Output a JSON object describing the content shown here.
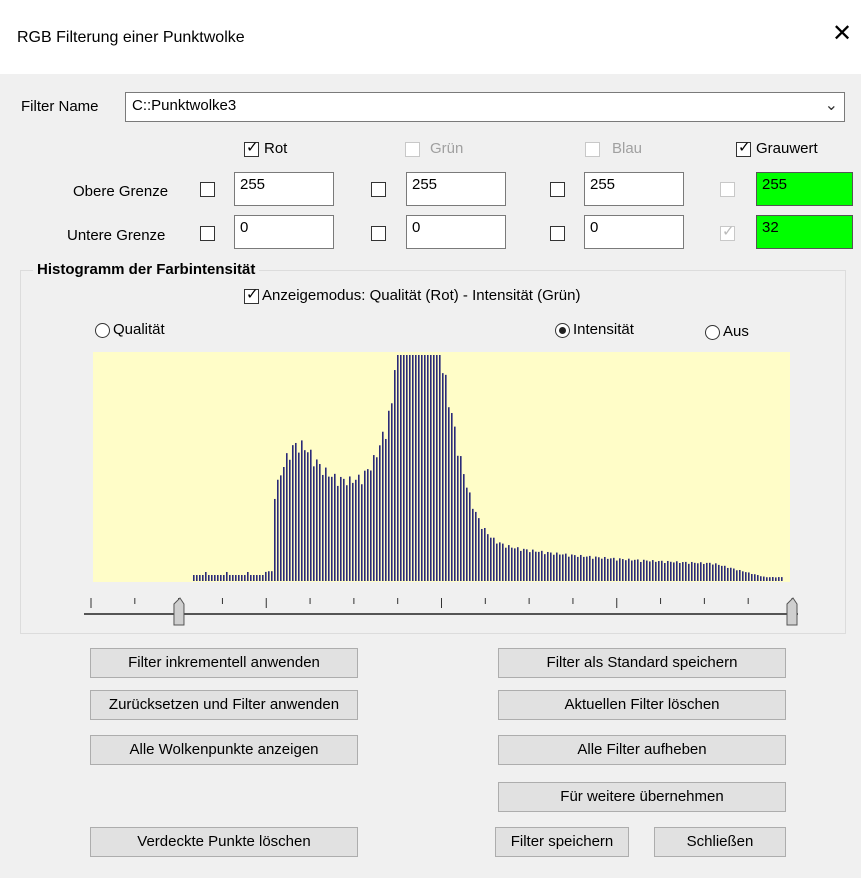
{
  "window": {
    "title": "RGB Filterung einer Punktwolke",
    "close_glyph": "✕"
  },
  "filter_name": {
    "label": "Filter Name",
    "value": "C::Punktwolke3"
  },
  "channels": [
    {
      "label": "Rot",
      "checked": true,
      "enabled": true
    },
    {
      "label": "Grün",
      "checked": false,
      "enabled": false
    },
    {
      "label": "Blau",
      "checked": false,
      "enabled": false
    },
    {
      "label": "Grauwert",
      "checked": true,
      "enabled": true
    }
  ],
  "upper": {
    "label": "Obere Grenze",
    "values": [
      "255",
      "255",
      "255",
      "255"
    ]
  },
  "lower": {
    "label": "Untere Grenze",
    "values": [
      "0",
      "0",
      "0",
      "32"
    ]
  },
  "histogram": {
    "title": "Histogramm der Farbintensität",
    "mode_label": "Anzeigemodus: Qualität (Rot) - Intensität (Grün)",
    "mode_checked": true,
    "radios": [
      {
        "label": "Qualität",
        "selected": false
      },
      {
        "label": "Intensität",
        "selected": true
      },
      {
        "label": "Aus",
        "selected": false
      }
    ],
    "fill_color": "#fffdc8",
    "bar_color": "#2a2a78",
    "slider": {
      "min": 0,
      "max": 255,
      "lower_value": 32,
      "upper_value": 255
    }
  },
  "buttons": {
    "inc_apply": "Filter inkrementell anwenden",
    "reset_apply": "Zurücksetzen und Filter anwenden",
    "show_all": "Alle Wolkenpunkte anzeigen",
    "delete_hidden": "Verdeckte Punkte löschen",
    "save_default": "Filter als Standard speichern",
    "delete_current": "Aktuellen Filter löschen",
    "clear_all": "Alle Filter aufheben",
    "apply_more": "Für weitere übernehmen",
    "save": "Filter speichern",
    "close": "Schließen"
  }
}
